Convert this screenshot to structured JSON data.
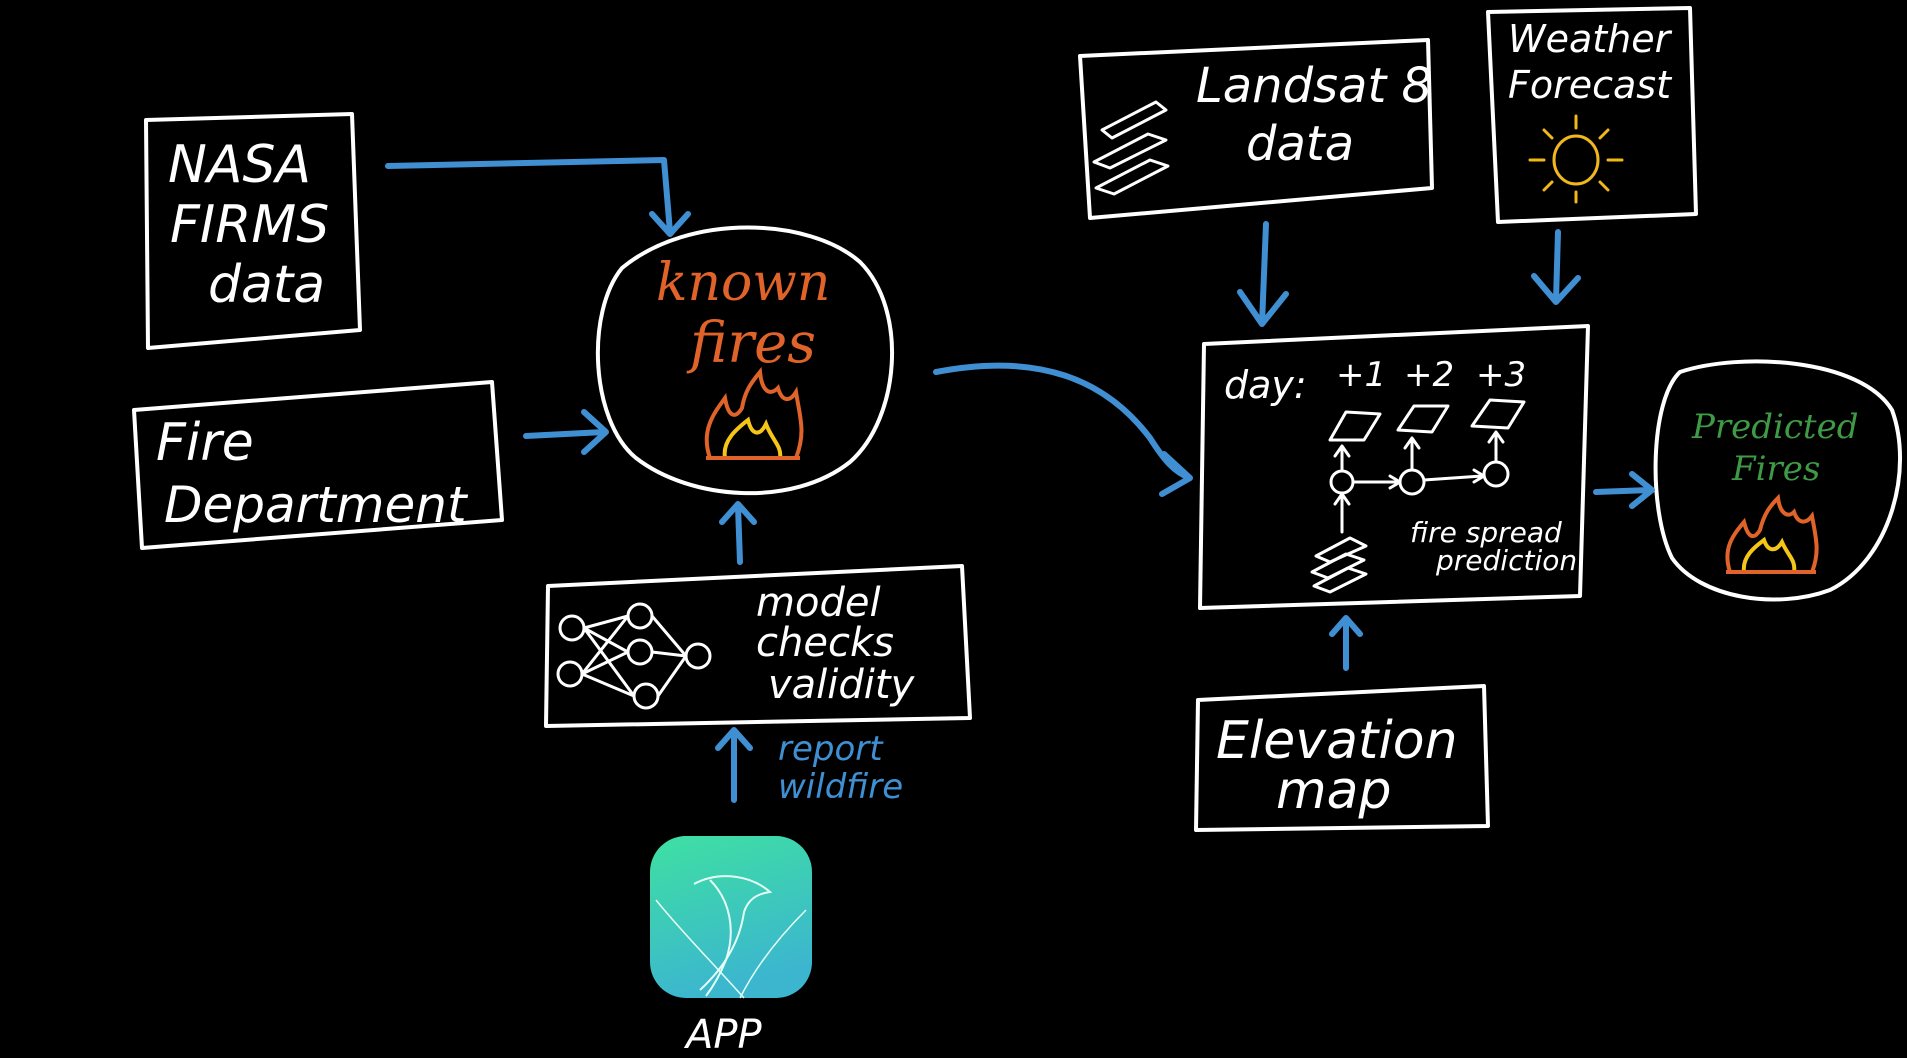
{
  "nodes": {
    "nasa_firms": {
      "lines": [
        "NASA",
        "FIRMS",
        "data"
      ]
    },
    "fire_department": {
      "lines": [
        "Fire",
        "Department"
      ]
    },
    "known_fires": {
      "lines": [
        "known",
        "fires"
      ]
    },
    "model_checks": {
      "lines": [
        "model",
        "checks",
        "validity"
      ]
    },
    "report_wildfire": {
      "lines": [
        "report",
        "wildfire"
      ]
    },
    "app": {
      "label": "APP"
    },
    "landsat": {
      "lines": [
        "Landsat 8",
        "data"
      ]
    },
    "weather": {
      "lines": [
        "Weather",
        "Forecast"
      ]
    },
    "spread_model": {
      "day_label": "day:",
      "days": [
        "+1",
        "+2",
        "+3"
      ],
      "caption": [
        "fire spread",
        "prediction"
      ]
    },
    "elevation": {
      "lines": [
        "Elevation",
        "map"
      ]
    },
    "predicted_fires": {
      "lines": [
        "Predicted",
        "Fires"
      ]
    }
  },
  "colors": {
    "background": "#000000",
    "stroke": "#ffffff",
    "arrow": "#3f8fd2",
    "known_fires_text": "#e0632a",
    "predicted_fires_text": "#3f9a45",
    "flame_outer": "#e0632a",
    "flame_inner": "#f5c518",
    "sun": "#f2b71c",
    "app_gradient_top": "#3ee0a2",
    "app_gradient_bottom": "#3cb6cf"
  }
}
